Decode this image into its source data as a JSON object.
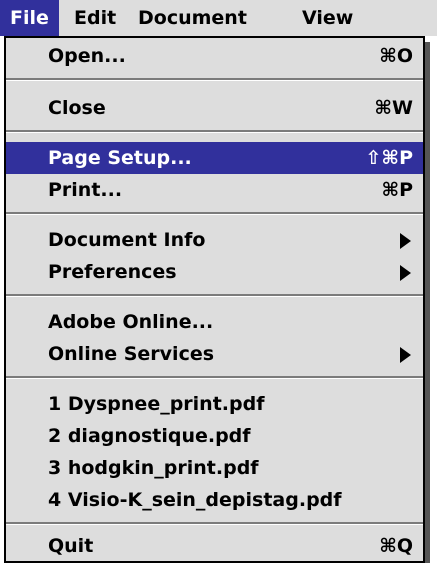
{
  "menubar": {
    "items": [
      {
        "label": "File"
      },
      {
        "label": "Edit"
      },
      {
        "label": "Document"
      },
      {
        "label": "View"
      }
    ]
  },
  "menu": {
    "open": {
      "label": "Open...",
      "shortcut": "⌘O"
    },
    "close": {
      "label": "Close",
      "shortcut": "⌘W"
    },
    "page_setup": {
      "label": "Page Setup...",
      "shortcut": "⇧⌘P"
    },
    "print": {
      "label": "Print...",
      "shortcut": "⌘P"
    },
    "document_info": {
      "label": "Document Info"
    },
    "preferences": {
      "label": "Preferences"
    },
    "adobe_online": {
      "label": "Adobe Online..."
    },
    "online_services": {
      "label": "Online Services"
    },
    "recent_files": [
      {
        "label": "1 Dyspnee_print.pdf"
      },
      {
        "label": "2 diagnostique.pdf"
      },
      {
        "label": "3 hodgkin_print.pdf"
      },
      {
        "label": "4 Visio-K_sein_depistag.pdf"
      }
    ],
    "quit": {
      "label": "Quit",
      "shortcut": "⌘Q"
    }
  },
  "colors": {
    "highlight": "#31309c",
    "menu_background": "#dddddd"
  }
}
